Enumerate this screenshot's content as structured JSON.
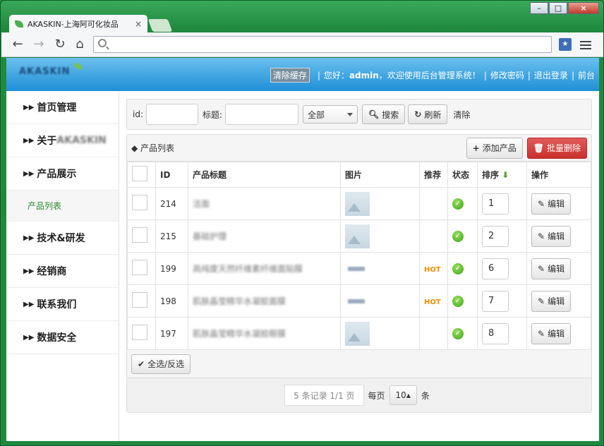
{
  "browser": {
    "tab_title": "AKASKIN-上海阿可化妆品",
    "tab_close": "×",
    "address": "",
    "window_controls": [
      "–",
      "□",
      "×"
    ]
  },
  "header": {
    "logo_text": "AKASKIN",
    "clear_cache": "清除缓存",
    "greeting_prefix": "您好：",
    "username": "admin",
    "greeting_suffix": "，欢迎使用后台管理系统！",
    "change_password": "修改密码",
    "logout": "退出登录",
    "frontend": "前台",
    "sep": "|"
  },
  "sidebar": {
    "items": [
      {
        "label": "首页管理"
      },
      {
        "label": "关于",
        "blurred": "AKASKIN"
      },
      {
        "label": "产品展示"
      },
      {
        "label": "技术&研发"
      },
      {
        "label": "经销商"
      },
      {
        "label": "联系我们"
      },
      {
        "label": "数据安全"
      }
    ],
    "sub_item": "产品列表"
  },
  "search": {
    "id_label": "id:",
    "title_label": "标题:",
    "select_value": "全部",
    "search_button": "搜索",
    "refresh_button": "刷新",
    "clear_link": "清除"
  },
  "panel": {
    "title": "产品列表",
    "add_button": "添加产品",
    "batch_delete_button": "批量删除"
  },
  "table": {
    "headers": [
      "",
      "ID",
      "产品标题",
      "图片",
      "推荐",
      "状态",
      "排序",
      "操作"
    ],
    "rows": [
      {
        "id": "214",
        "title": "洁面",
        "hot": "",
        "sort": "1",
        "edit": "编辑"
      },
      {
        "id": "215",
        "title": "基础护理",
        "hot": "",
        "sort": "2",
        "edit": "编辑"
      },
      {
        "id": "199",
        "title": "高纯度天然纤维素纤维面贴膜",
        "hot": "HOT",
        "sort": "6",
        "edit": "编辑"
      },
      {
        "id": "198",
        "title": "肌肤晶莹精华水凝胶面膜",
        "hot": "HOT",
        "sort": "7",
        "edit": "编辑"
      },
      {
        "id": "197",
        "title": "肌肤晶莹精华水凝胶眼膜",
        "hot": "",
        "sort": "8",
        "edit": "编辑"
      }
    ]
  },
  "footer": {
    "select_all": "全选/反选",
    "records": "5 条记录 1/1 页",
    "per_page_label": "每页",
    "per_page_value": "10",
    "per_page_unit": "条"
  }
}
